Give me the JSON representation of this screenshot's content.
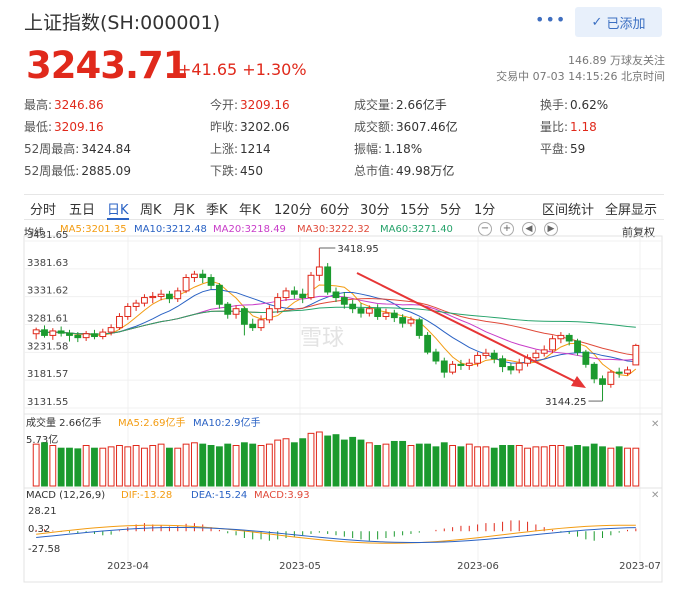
{
  "header": {
    "title": "上证指数(SH:000001)",
    "more_label": "•••",
    "add_label": "已添加",
    "price": "3243.71",
    "change": "+41.65 +1.30%",
    "followers": "146.89 万球友关注",
    "trade_status": "交易中 07-03 14:15:26 北京时间"
  },
  "quote": {
    "rows": [
      [
        {
          "label": "最高:",
          "value": "3246.86",
          "color": "red"
        },
        {
          "label": "今开:",
          "value": "3209.16",
          "color": "red"
        },
        {
          "label": "成交量:",
          "value": "2.66亿手",
          "color": "black"
        },
        {
          "label": "换手:",
          "value": "0.62%",
          "color": "black"
        }
      ],
      [
        {
          "label": "最低:",
          "value": "3209.16",
          "color": "red"
        },
        {
          "label": "昨收:",
          "value": "3202.06",
          "color": "black"
        },
        {
          "label": "成交额:",
          "value": "3607.46亿",
          "color": "black"
        },
        {
          "label": "量比:",
          "value": "1.18",
          "color": "red"
        }
      ],
      [
        {
          "label": "52周最高:",
          "value": "3424.84",
          "color": "black"
        },
        {
          "label": "上涨:",
          "value": "1214",
          "color": "black"
        },
        {
          "label": "振幅:",
          "value": "1.18%",
          "color": "black"
        },
        {
          "label": "平盘:",
          "value": "59",
          "color": "black"
        }
      ],
      [
        {
          "label": "52周最低:",
          "value": "2885.09",
          "color": "black"
        },
        {
          "label": "下跌:",
          "value": "450",
          "color": "black"
        },
        {
          "label": "总市值:",
          "value": "49.98万亿",
          "color": "black"
        }
      ]
    ]
  },
  "tabs": [
    "分时",
    "五日",
    "日K",
    "周K",
    "月K",
    "季K",
    "年K",
    "120分",
    "60分",
    "30分",
    "15分",
    "5分",
    "1分"
  ],
  "active_tab": "日K",
  "right_tabs": [
    "区间统计",
    "全屏显示"
  ],
  "chart_header": {
    "mode": "均线",
    "ma": [
      {
        "label": "MA5:3201.35",
        "color": "#f39c12"
      },
      {
        "label": "MA10:3212.48",
        "color": "#2a62c4"
      },
      {
        "label": "MA20:3218.49",
        "color": "#c83cc8"
      },
      {
        "label": "MA30:3222.32",
        "color": "#e04a3a"
      },
      {
        "label": "MA60:3271.40",
        "color": "#27a36b"
      }
    ],
    "restore": "前复权",
    "ctrl_icons": [
      "minus-icon",
      "plus-icon",
      "left-icon",
      "right-icon"
    ]
  },
  "volume_header": {
    "label": "成交量 2.66亿手",
    "ma": [
      {
        "label": "MA5:2.69亿手",
        "color": "#f39c12"
      },
      {
        "label": "MA10:2.9亿手",
        "color": "#2a62c4"
      }
    ],
    "max": "5.73亿"
  },
  "macd_header": {
    "label": "MACD (12,26,9)",
    "items": [
      {
        "label": "DIF:-13.28",
        "color": "#f39c12"
      },
      {
        "label": "DEA:-15.24",
        "color": "#2a62c4"
      },
      {
        "label": "MACD:3.93",
        "color": "#e04a3a"
      }
    ]
  },
  "watermark": "雪球",
  "chart_data": {
    "type": "candlestick",
    "yticks": [
      "3431.65",
      "3381.63",
      "3331.62",
      "3281.61",
      "3231.58",
      "3181.57",
      "3131.55"
    ],
    "ylim": [
      3131.55,
      3431.65
    ],
    "xticks": [
      "2023-04",
      "2023-05",
      "2023-06",
      "2023-07"
    ],
    "annotations": {
      "high": "3418.95",
      "low": "3144.25"
    },
    "macd_ticks": [
      "28.21",
      "0.32",
      "-27.58"
    ],
    "candles": [
      [
        3265,
        3272,
        3255,
        3276
      ],
      [
        3272,
        3262,
        3258,
        3280
      ],
      [
        3262,
        3270,
        3254,
        3275
      ],
      [
        3270,
        3266,
        3260,
        3278
      ],
      [
        3266,
        3262,
        3251,
        3272
      ],
      [
        3262,
        3258,
        3250,
        3268
      ],
      [
        3258,
        3265,
        3252,
        3270
      ],
      [
        3265,
        3260,
        3255,
        3272
      ],
      [
        3260,
        3268,
        3255,
        3274
      ],
      [
        3268,
        3276,
        3262,
        3282
      ],
      [
        3276,
        3296,
        3272,
        3302
      ],
      [
        3296,
        3314,
        3290,
        3320
      ],
      [
        3314,
        3320,
        3306,
        3326
      ],
      [
        3320,
        3330,
        3314,
        3336
      ],
      [
        3330,
        3332,
        3320,
        3340
      ],
      [
        3332,
        3336,
        3325,
        3344
      ],
      [
        3336,
        3328,
        3320,
        3342
      ],
      [
        3328,
        3342,
        3322,
        3348
      ],
      [
        3342,
        3366,
        3338,
        3372
      ],
      [
        3366,
        3372,
        3358,
        3378
      ],
      [
        3372,
        3366,
        3356,
        3380
      ],
      [
        3366,
        3352,
        3345,
        3372
      ],
      [
        3352,
        3318,
        3310,
        3356
      ],
      [
        3318,
        3300,
        3292,
        3322
      ],
      [
        3300,
        3310,
        3292,
        3316
      ],
      [
        3310,
        3282,
        3262,
        3314
      ],
      [
        3282,
        3276,
        3270,
        3292
      ],
      [
        3276,
        3290,
        3270,
        3298
      ],
      [
        3290,
        3310,
        3284,
        3316
      ],
      [
        3310,
        3330,
        3302,
        3338
      ],
      [
        3330,
        3342,
        3324,
        3348
      ],
      [
        3342,
        3336,
        3328,
        3350
      ],
      [
        3336,
        3330,
        3320,
        3346
      ],
      [
        3330,
        3370,
        3326,
        3376
      ],
      [
        3370,
        3385,
        3360,
        3419
      ],
      [
        3385,
        3340,
        3335,
        3392
      ],
      [
        3340,
        3330,
        3322,
        3348
      ],
      [
        3330,
        3318,
        3310,
        3340
      ],
      [
        3318,
        3310,
        3302,
        3326
      ],
      [
        3310,
        3302,
        3294,
        3320
      ],
      [
        3302,
        3310,
        3296,
        3316
      ],
      [
        3310,
        3296,
        3290,
        3318
      ],
      [
        3296,
        3302,
        3290,
        3310
      ],
      [
        3302,
        3294,
        3286,
        3308
      ],
      [
        3294,
        3284,
        3276,
        3300
      ],
      [
        3284,
        3290,
        3278,
        3296
      ],
      [
        3290,
        3262,
        3256,
        3294
      ],
      [
        3262,
        3232,
        3228,
        3268
      ],
      [
        3232,
        3216,
        3210,
        3238
      ],
      [
        3216,
        3196,
        3186,
        3222
      ],
      [
        3196,
        3210,
        3192,
        3216
      ],
      [
        3210,
        3208,
        3200,
        3218
      ],
      [
        3208,
        3212,
        3200,
        3220
      ],
      [
        3212,
        3226,
        3206,
        3232
      ],
      [
        3226,
        3230,
        3220,
        3238
      ],
      [
        3230,
        3220,
        3212,
        3236
      ],
      [
        3220,
        3206,
        3196,
        3226
      ],
      [
        3206,
        3200,
        3192,
        3212
      ],
      [
        3200,
        3212,
        3194,
        3220
      ],
      [
        3212,
        3222,
        3206,
        3228
      ],
      [
        3222,
        3230,
        3216,
        3236
      ],
      [
        3230,
        3236,
        3224,
        3244
      ],
      [
        3236,
        3256,
        3230,
        3262
      ],
      [
        3256,
        3262,
        3248,
        3268
      ],
      [
        3262,
        3252,
        3244,
        3266
      ],
      [
        3252,
        3232,
        3226,
        3256
      ],
      [
        3232,
        3210,
        3204,
        3236
      ],
      [
        3210,
        3184,
        3176,
        3214
      ],
      [
        3184,
        3174,
        3144,
        3190
      ],
      [
        3174,
        3196,
        3168,
        3200
      ],
      [
        3196,
        3194,
        3186,
        3204
      ],
      [
        3194,
        3200,
        3190,
        3206
      ],
      [
        3209,
        3244,
        3209,
        3247
      ]
    ],
    "volumes": [
      0.62,
      0.64,
      0.6,
      0.56,
      0.56,
      0.55,
      0.6,
      0.56,
      0.56,
      0.58,
      0.6,
      0.58,
      0.6,
      0.56,
      0.6,
      0.62,
      0.56,
      0.56,
      0.62,
      0.64,
      0.62,
      0.6,
      0.58,
      0.62,
      0.6,
      0.64,
      0.62,
      0.6,
      0.62,
      0.68,
      0.7,
      0.64,
      0.7,
      0.78,
      0.8,
      0.74,
      0.76,
      0.68,
      0.72,
      0.68,
      0.64,
      0.6,
      0.62,
      0.66,
      0.66,
      0.6,
      0.62,
      0.62,
      0.58,
      0.64,
      0.6,
      0.58,
      0.62,
      0.58,
      0.58,
      0.56,
      0.6,
      0.6,
      0.6,
      0.56,
      0.58,
      0.58,
      0.6,
      0.6,
      0.58,
      0.6,
      0.58,
      0.62,
      0.58,
      0.56,
      0.58,
      0.56,
      0.56
    ],
    "macd": [
      2,
      3,
      1,
      -1,
      -2,
      -3,
      -2,
      -4,
      -6,
      -5,
      1,
      6,
      10,
      12,
      10,
      9,
      7,
      8,
      11,
      12,
      10,
      6,
      2,
      -3,
      -6,
      -10,
      -12,
      -12,
      -14,
      -12,
      -10,
      -8,
      -6,
      -4,
      -2,
      -4,
      -6,
      -8,
      -10,
      -12,
      -14,
      -12,
      -10,
      -8,
      -6,
      -4,
      -2,
      0,
      2,
      4,
      6,
      8,
      8,
      10,
      12,
      12,
      14,
      16,
      16,
      14,
      10,
      6,
      2,
      -2,
      -4,
      -8,
      -12,
      -14,
      -10,
      -6,
      -2,
      2,
      4
    ]
  }
}
